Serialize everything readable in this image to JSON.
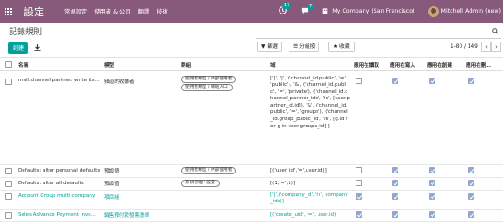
{
  "nav": {
    "title": "設定",
    "menus": [
      "常規設定",
      "使用者 & 公司",
      "翻譯",
      "技術"
    ],
    "activity_count": "17",
    "message_count": "7",
    "company": "My Company (San Francisco)",
    "user": "Mitchell Admin (new)",
    "brand_color": "#875a7b",
    "accent_color": "#00a09d"
  },
  "control": {
    "page_title": "記錄規則",
    "create_label": "創建",
    "filters_label": "篩選",
    "groupby_label": "分組按",
    "favorites_label": "收藏",
    "pager": "1-80 / 149"
  },
  "table": {
    "headers": [
      "名稱",
      "模型",
      "群組",
      "域",
      "應用在讀取",
      "應用在寫入",
      "應用在創建",
      "應用在刪…"
    ],
    "rows": [
      {
        "name": "mail.channel partner: write its...",
        "model": "頻道的收聽者",
        "groups": [
          "使用者類型 / 內部使用者",
          "使用者類型 / 網站入口"
        ],
        "domain": "['|', '|', ('channel_id.public', '=', 'public'), '&', ('channel_id.public', '=', 'private'), ('channel_id.channel_partner_ids', 'in', [user.partner_id.id]), '&', ('channel_id.public', '=', 'groups'), ('channel_id.group_public_id', 'in', [g.id for g in user.groups_id])]",
        "read": false,
        "write": true,
        "create": true,
        "unlink": true,
        "is_link": false
      },
      {
        "name": "Defaults: alter personal defaults",
        "model": "預設值",
        "groups": [
          "使用者類型 / 內部使用者"
        ],
        "domain": "[('user_id','=',user.id)]",
        "read": false,
        "write": true,
        "create": true,
        "unlink": true,
        "is_link": false
      },
      {
        "name": "Defaults: alter all defaults",
        "model": "預設值",
        "groups": [
          "系統管理 / 設置"
        ],
        "domain": "[(1,'=',1)]",
        "read": false,
        "write": true,
        "create": true,
        "unlink": true,
        "is_link": false
      },
      {
        "name": "Account Group multi-company",
        "model": "項目組",
        "groups": [],
        "domain": "['|',('company_id','in', company_ids)]",
        "read": true,
        "write": true,
        "create": true,
        "unlink": true,
        "is_link": true
      },
      {
        "name": "Sales Advance Payment Invo...",
        "model": "銷售預付款發票憑單",
        "groups": [],
        "domain": "[('create_uid', '=', user.id)]",
        "read": true,
        "write": true,
        "create": true,
        "unlink": true,
        "is_link": true
      }
    ]
  }
}
